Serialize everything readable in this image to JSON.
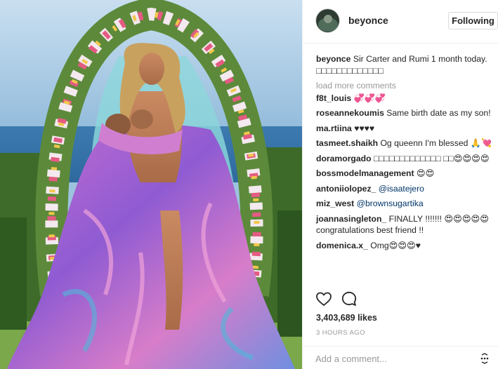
{
  "post": {
    "photo_subject": "photo-portrait-flower-arch",
    "header": {
      "username": "beyonce",
      "follow_label": "Following"
    },
    "caption": {
      "username": "beyonce",
      "text": "Sir Carter and Rumi 1 month today. □□□□□□□□□□□□□"
    },
    "load_more_label": "load more comments",
    "comments": [
      {
        "username": "f8t_louis",
        "text": "💞💞💞",
        "mention": ""
      },
      {
        "username": "roseannekoumis",
        "text": "Same birth date as my son!",
        "mention": ""
      },
      {
        "username": "ma.rtiina",
        "text": "♥♥♥♥",
        "mention": ""
      },
      {
        "username": "tasmeet.shaikh",
        "text": "Og queenn I'm blessed 🙏💘",
        "mention": ""
      },
      {
        "username": "doramorgado",
        "text": "□□□□□□□□□□□□□ □□😍😍😍😍",
        "mention": ""
      },
      {
        "username": "bossmodelmanagement",
        "text": "😍😍",
        "mention": ""
      },
      {
        "username": "antoniiolopez_",
        "text": "",
        "mention": "@isaatejero"
      },
      {
        "username": "miz_west",
        "text": "",
        "mention": "@brownsugartika"
      },
      {
        "username": "joannasingleton_",
        "text": "FINALLY !!!!!!! 😍😍😍😍😍 congratulations best friend !!",
        "mention": ""
      },
      {
        "username": "domenica.x_",
        "text": "Omg😍😍😍♥",
        "mention": ""
      }
    ],
    "likes": "3,403,689 likes",
    "time": "3 HOURS AGO",
    "add_comment_placeholder": "Add a comment...",
    "icons": {
      "like": "heart-icon",
      "comment": "comment-bubble-icon",
      "more": "more-options-icon"
    }
  }
}
